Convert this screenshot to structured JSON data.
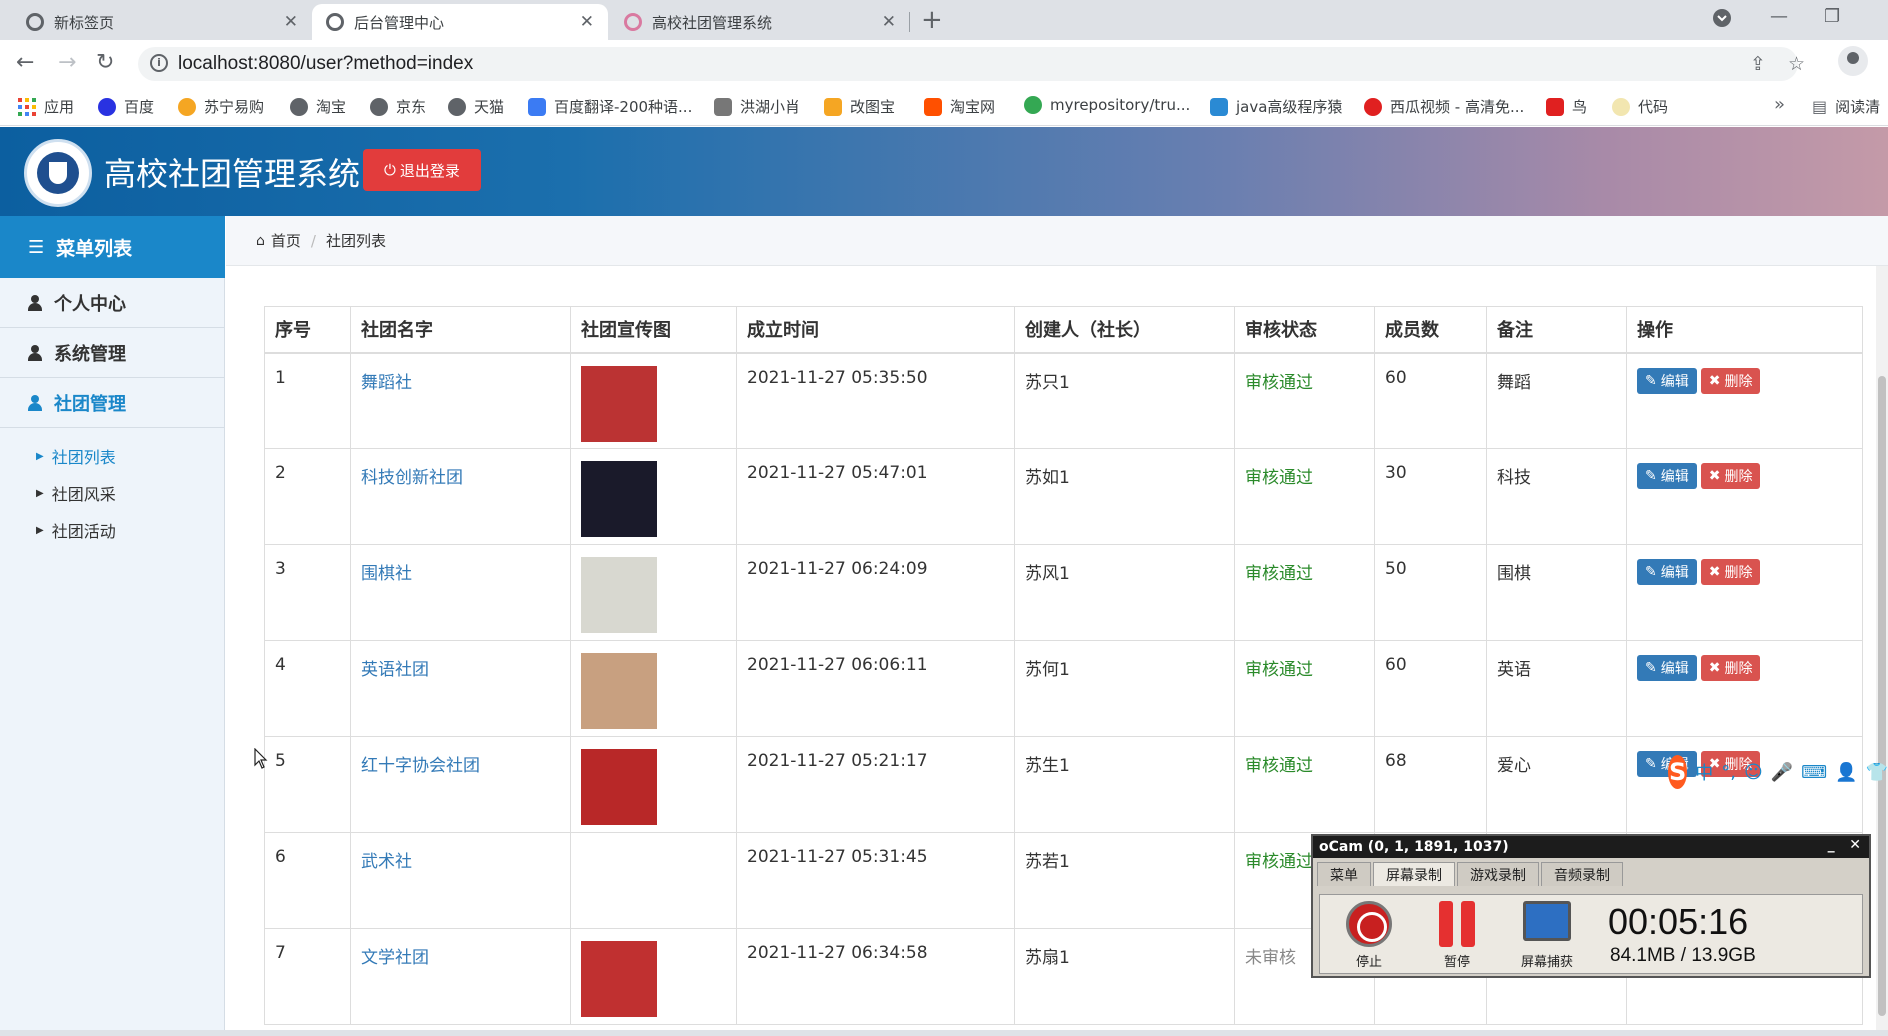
{
  "browser": {
    "tabs": [
      {
        "title": "新标签页",
        "close": "✕"
      },
      {
        "title": "后台管理中心",
        "close": "✕"
      },
      {
        "title": "高校社团管理系统",
        "close": "✕"
      }
    ],
    "new_tab": "+",
    "url": "localhost:8080/user?method=index",
    "bookmarks": [
      {
        "label": "应用",
        "color": "#ea4335"
      },
      {
        "label": "百度",
        "color": "#2932e1"
      },
      {
        "label": "苏宁易购",
        "color": "#f5a623"
      },
      {
        "label": "淘宝",
        "color": "#5f6368"
      },
      {
        "label": "京东",
        "color": "#5f6368"
      },
      {
        "label": "天猫",
        "color": "#5f6368"
      },
      {
        "label": "百度翻译-200种语...",
        "color": "#3b7bf3"
      },
      {
        "label": "洪湖小肖",
        "color": "#777777"
      },
      {
        "label": "改图宝",
        "color": "#f5a623"
      },
      {
        "label": "淘宝网",
        "color": "#ff5000"
      },
      {
        "label": "myrepository/tru...",
        "color": "#34a853"
      },
      {
        "label": "java高级程序猿",
        "color": "#2a8ad4"
      },
      {
        "label": "西瓜视频 - 高清免...",
        "color": "#e02020"
      },
      {
        "label": "鸟",
        "color": "#e02020"
      },
      {
        "label": "代码",
        "color": "#f2e6b0"
      }
    ],
    "bookmarks_more": "»",
    "reading_list": "阅读清"
  },
  "header": {
    "title": "高校社团管理系统",
    "logout_label": "退出登录"
  },
  "sidebar": {
    "heading": "菜单列表",
    "items": [
      {
        "label": "个人中心"
      },
      {
        "label": "系统管理"
      },
      {
        "label": "社团管理"
      }
    ],
    "subitems": [
      {
        "label": "社团列表"
      },
      {
        "label": "社团风采"
      },
      {
        "label": "社团活动"
      }
    ]
  },
  "breadcrumb": {
    "home": "首页",
    "current": "社团列表"
  },
  "table": {
    "headers": [
      "序号",
      "社团名字",
      "社团宣传图",
      "成立时间",
      "创建人（社长）",
      "审核状态",
      "成员数",
      "备注",
      "操作"
    ],
    "edit_label": "编辑",
    "delete_label": "删除",
    "rows": [
      {
        "no": "1",
        "name": "舞蹈社",
        "time": "2021-11-27 05:35:50",
        "creator": "苏只1",
        "status": "审核通过",
        "members": "60",
        "remark": "舞蹈",
        "img": "#b33"
      },
      {
        "no": "2",
        "name": "科技创新社团",
        "time": "2021-11-27 05:47:01",
        "creator": "苏如1",
        "status": "审核通过",
        "members": "30",
        "remark": "科技",
        "img": "#1a1a2a"
      },
      {
        "no": "3",
        "name": "围棋社",
        "time": "2021-11-27 06:24:09",
        "creator": "苏风1",
        "status": "审核通过",
        "members": "50",
        "remark": "围棋",
        "img": "#d8d8d0"
      },
      {
        "no": "4",
        "name": "英语社团",
        "time": "2021-11-27 06:06:11",
        "creator": "苏何1",
        "status": "审核通过",
        "members": "60",
        "remark": "英语",
        "img": "#c8a080"
      },
      {
        "no": "5",
        "name": "红十字协会社团",
        "time": "2021-11-27 05:21:17",
        "creator": "苏生1",
        "status": "审核通过",
        "members": "68",
        "remark": "爱心",
        "img": "#b82828"
      },
      {
        "no": "6",
        "name": "武术社",
        "time": "2021-11-27 05:31:45",
        "creator": "苏若1",
        "status": "审核通过",
        "members": "",
        "remark": "",
        "img": "#ffffff"
      },
      {
        "no": "7",
        "name": "文学社团",
        "time": "2021-11-27 06:34:58",
        "creator": "苏扇1",
        "status": "未审核",
        "members": "",
        "remark": "",
        "img": "#c03030"
      }
    ]
  },
  "ime": {
    "logo": "S",
    "items": [
      "中",
      "°,",
      "☺",
      "🎤",
      "⌨",
      "👤",
      "👕"
    ]
  },
  "ocam": {
    "title": "oCam (0, 1, 1891, 1037)",
    "tabs": [
      "菜单",
      "屏幕录制",
      "游戏录制",
      "音频录制"
    ],
    "stop": "停止",
    "pause": "暂停",
    "capture": "屏幕捕获",
    "time": "00:05:16",
    "size": "84.1MB / 13.9GB"
  },
  "colors": {
    "brand": "#1a87c9",
    "danger": "#e23c3c",
    "link": "#337ab7",
    "ok": "#2a8a2a"
  }
}
